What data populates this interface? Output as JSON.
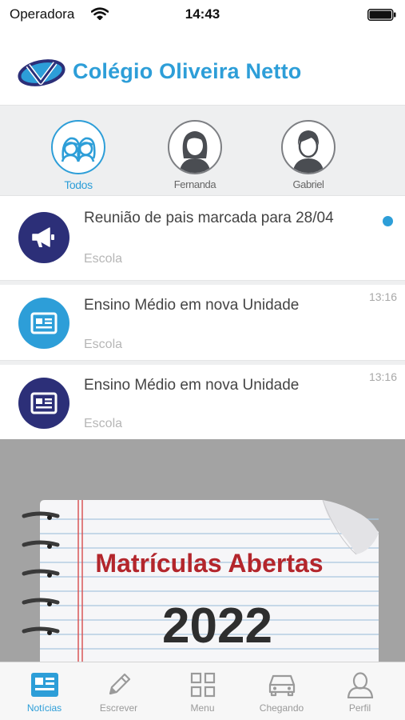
{
  "status_bar": {
    "carrier": "Operadora",
    "time": "14:43"
  },
  "header": {
    "school_name": "Colégio Oliveira Netto"
  },
  "filters": [
    {
      "label": "Todos",
      "icon": "group-icon",
      "active": true
    },
    {
      "label": "Fernanda",
      "icon": "girl-avatar-icon",
      "active": false
    },
    {
      "label": "Gabriel",
      "icon": "boy-avatar-icon",
      "active": false
    }
  ],
  "feed": [
    {
      "title": "Reunião de pais marcada para 28/04",
      "source": "Escola",
      "time": "",
      "unread": true,
      "icon": "megaphone-icon",
      "icon_color": "#2c2f78"
    },
    {
      "title": "Ensino Médio em nova Unidade",
      "source": "Escola",
      "time": "13:16",
      "unread": false,
      "icon": "newspaper-icon",
      "icon_color": "#2d9ed8"
    },
    {
      "title": "Ensino Médio em nova Unidade",
      "source": "Escola",
      "time": "13:16",
      "unread": false,
      "icon": "newspaper-icon",
      "icon_color": "#2c2f78"
    }
  ],
  "banner": {
    "heading": "Matrículas Abertas",
    "year": "2022"
  },
  "tabs": [
    {
      "label": "Notícias",
      "icon": "news-icon",
      "active": true
    },
    {
      "label": "Escrever",
      "icon": "pencil-icon",
      "active": false
    },
    {
      "label": "Menu",
      "icon": "grid-icon",
      "active": false
    },
    {
      "label": "Chegando",
      "icon": "car-icon",
      "active": false
    },
    {
      "label": "Perfil",
      "icon": "person-icon",
      "active": false
    }
  ],
  "colors": {
    "accent": "#2d9ed8",
    "navy": "#2c2f78",
    "inactive": "#9a9a9a"
  }
}
